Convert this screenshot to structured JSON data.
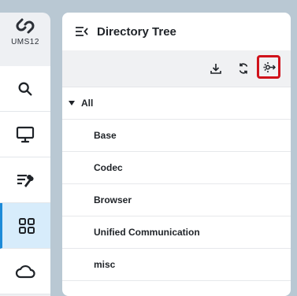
{
  "app": {
    "logo_text": "UMS12"
  },
  "nav": {
    "items": [
      {
        "icon": "search-icon"
      },
      {
        "icon": "monitor-icon"
      },
      {
        "icon": "configuration-icon"
      },
      {
        "icon": "apps-grid-icon",
        "active": true
      },
      {
        "icon": "cloud-icon"
      }
    ]
  },
  "panel": {
    "title": "Directory Tree",
    "toolbar": {
      "buttons": [
        {
          "icon": "download-icon"
        },
        {
          "icon": "sync-icon"
        },
        {
          "icon": "settings-export-icon",
          "highlighted": true
        }
      ]
    },
    "tree": {
      "root": "All",
      "children": [
        "Base",
        "Codec",
        "Browser",
        "Unified Communication",
        "misc"
      ]
    }
  },
  "colors": {
    "accent": "#1c8ad8",
    "highlight": "#d0121b",
    "active_bg": "#d7ecfb"
  }
}
